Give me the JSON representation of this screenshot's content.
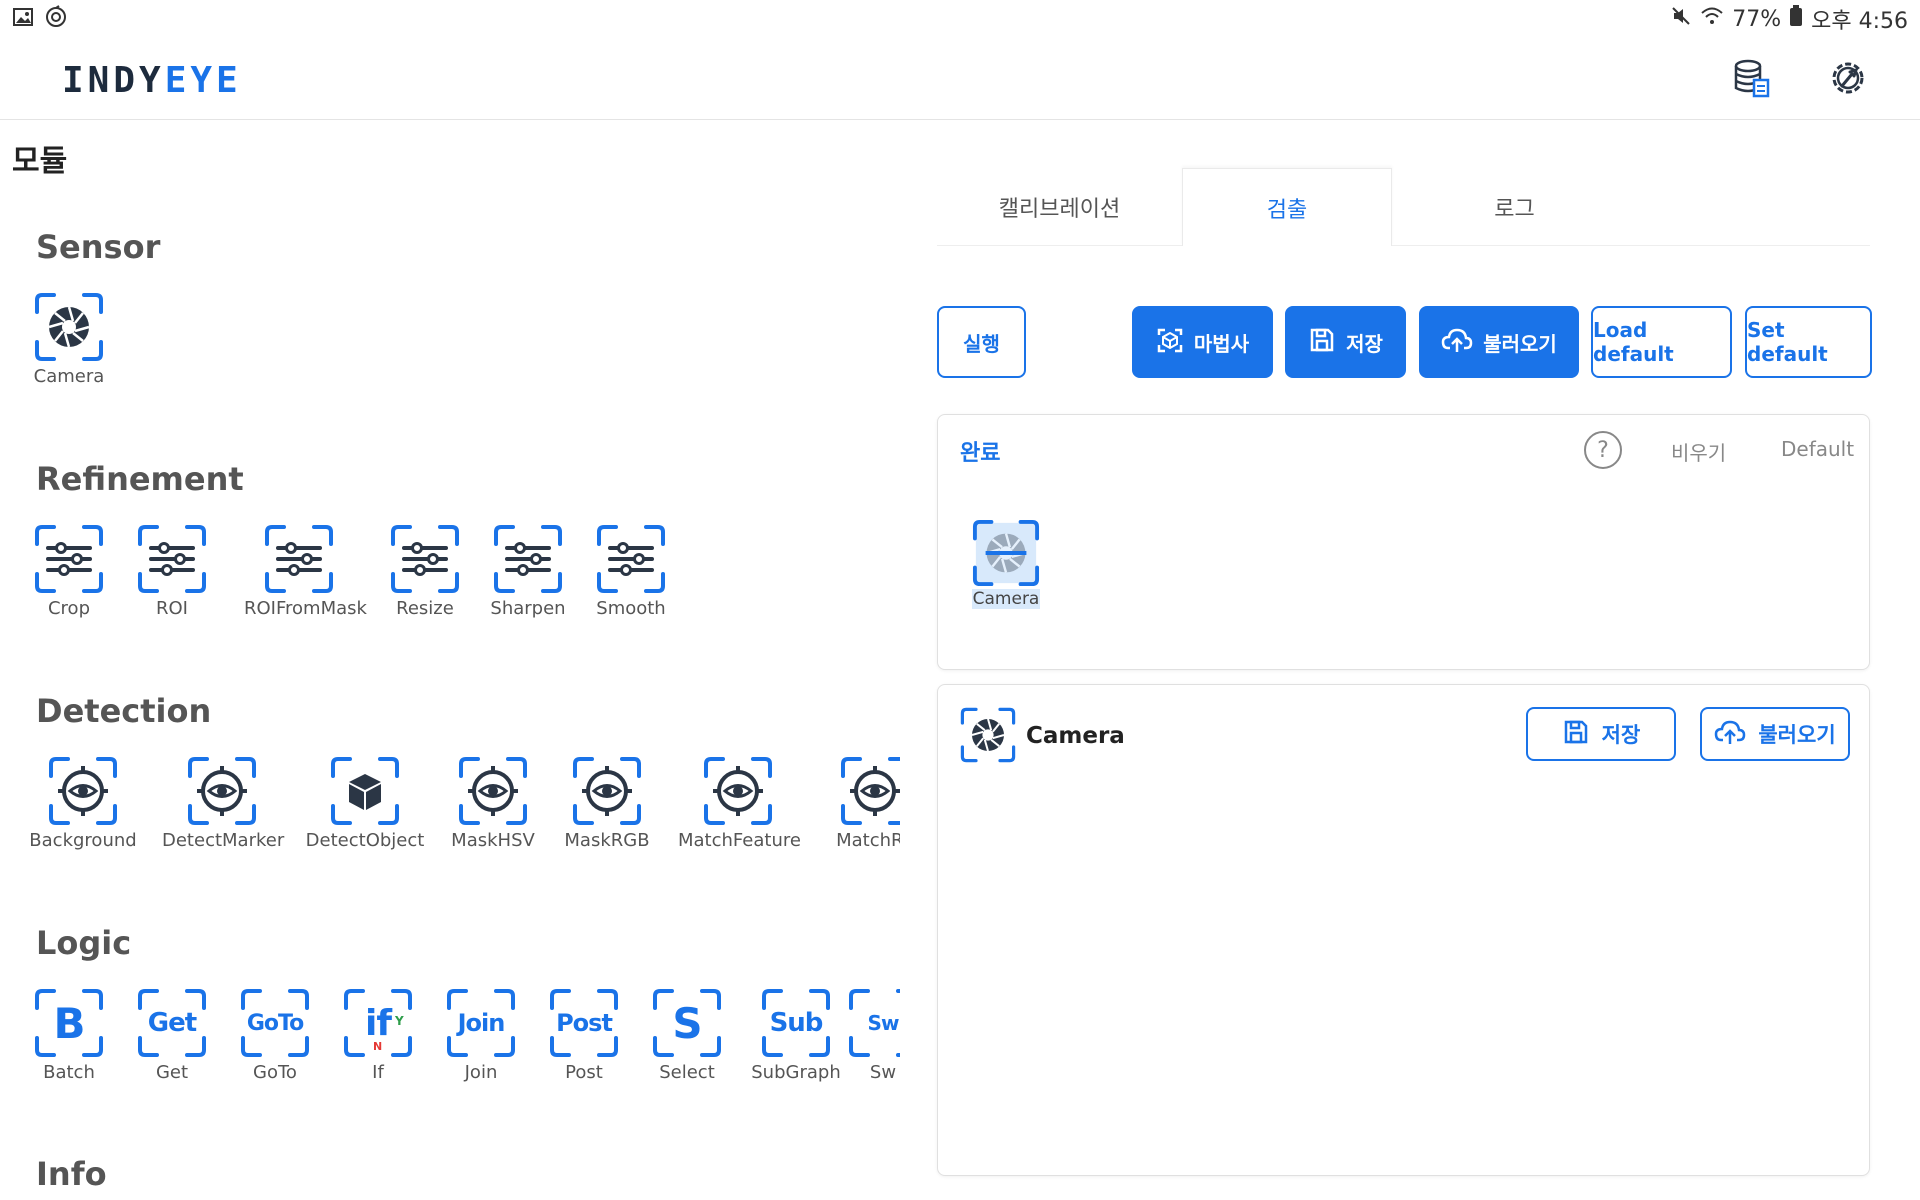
{
  "statusbar": {
    "battery": "77%",
    "time": "오후 4:56"
  },
  "app": {
    "logo_part1": "INDY",
    "logo_part2": "EYE"
  },
  "page_title": "모듈",
  "sections": {
    "sensor": {
      "title": "Sensor",
      "items": [
        "Camera"
      ]
    },
    "refinement": {
      "title": "Refinement",
      "items": [
        "Crop",
        "ROI",
        "ROIFromMask",
        "Resize",
        "Sharpen",
        "Smooth"
      ]
    },
    "detection": {
      "title": "Detection",
      "items": [
        "Background",
        "DetectMarker",
        "DetectObject",
        "MaskHSV",
        "MaskRGB",
        "MatchFeature",
        "MatchRF"
      ]
    },
    "logic": {
      "title": "Logic",
      "items": [
        {
          "glyph": "B",
          "label": "Batch"
        },
        {
          "glyph": "Get",
          "label": "Get"
        },
        {
          "glyph": "GoTo",
          "label": "GoTo"
        },
        {
          "glyph": "if",
          "label": "If",
          "yes": "Y",
          "no": "N"
        },
        {
          "glyph": "Join",
          "label": "Join"
        },
        {
          "glyph": "Post",
          "label": "Post"
        },
        {
          "glyph": "S",
          "label": "Select"
        },
        {
          "glyph": "Sub",
          "label": "SubGraph"
        },
        {
          "glyph": "Sw",
          "label": "Sw"
        }
      ]
    },
    "info": {
      "title": "Info"
    }
  },
  "tabs": [
    {
      "label": "캘리브레이션",
      "active": false
    },
    {
      "label": "검출",
      "active": true
    },
    {
      "label": "로그",
      "active": false
    }
  ],
  "toolbar": {
    "run": "실행",
    "wizard": "마법사",
    "save": "저장",
    "load": "불러오기",
    "load_default": "Load default",
    "set_default": "Set default"
  },
  "graph_panel": {
    "status": "완료",
    "help": "?",
    "clear": "비우기",
    "default": "Default",
    "nodes": [
      "Camera"
    ]
  },
  "detail_panel": {
    "title": "Camera",
    "save": "저장",
    "load": "불러오기"
  },
  "colors": {
    "accent": "#1a73e8",
    "dark_icon": "#2b3645",
    "success_y": "#2e9d4a",
    "no_n": "#e53935"
  }
}
